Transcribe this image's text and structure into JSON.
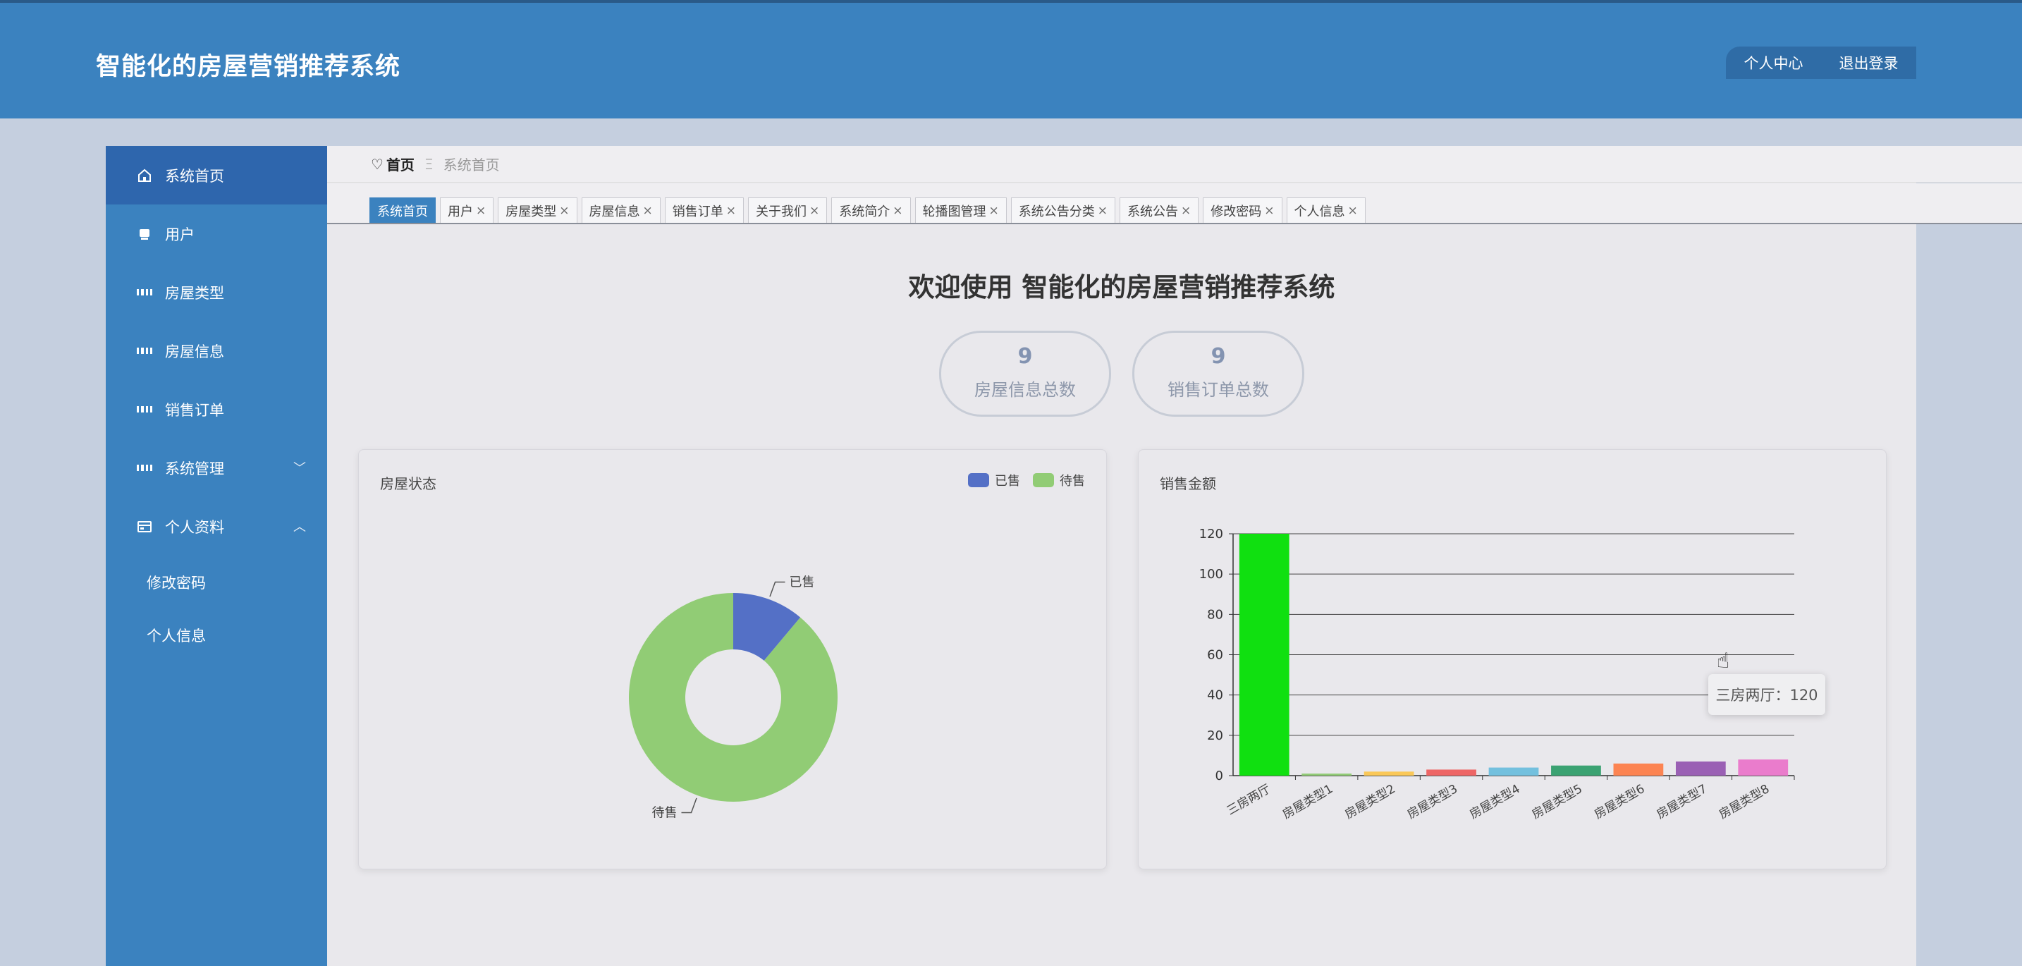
{
  "header": {
    "title": "智能化的房屋营销推荐系统",
    "personal_center": "个人中心",
    "logout": "退出登录"
  },
  "sidebar": {
    "items": [
      {
        "label": "系统首页",
        "icon": "home-icon"
      },
      {
        "label": "用户",
        "icon": "user-icon"
      },
      {
        "label": "房屋类型",
        "icon": "grid-icon"
      },
      {
        "label": "房屋信息",
        "icon": "grid-icon"
      },
      {
        "label": "销售订单",
        "icon": "grid-icon"
      },
      {
        "label": "系统管理",
        "icon": "grid-icon",
        "arrow": "chevron-down-icon"
      },
      {
        "label": "个人资料",
        "icon": "profile-card-icon",
        "arrow": "chevron-up-icon"
      }
    ],
    "subitems": [
      {
        "label": "修改密码"
      },
      {
        "label": "个人信息"
      }
    ]
  },
  "breadcrumb": {
    "home": "首页",
    "separator": "Ξ",
    "current": "系统首页"
  },
  "tabs": [
    {
      "label": "系统首页",
      "closable": false
    },
    {
      "label": "用户"
    },
    {
      "label": "房屋类型"
    },
    {
      "label": "房屋信息"
    },
    {
      "label": "销售订单"
    },
    {
      "label": "关于我们"
    },
    {
      "label": "系统简介"
    },
    {
      "label": "轮播图管理"
    },
    {
      "label": "系统公告分类"
    },
    {
      "label": "系统公告"
    },
    {
      "label": "修改密码"
    },
    {
      "label": "个人信息"
    }
  ],
  "close_glyph": "×",
  "welcome": "欢迎使用 智能化的房屋营销推荐系统",
  "stats": [
    {
      "value": "9",
      "label": "房屋信息总数"
    },
    {
      "value": "9",
      "label": "销售订单总数"
    }
  ],
  "colors": {
    "header_bg": "#3b82bf",
    "sidebar_active": "#2e66ad",
    "pie_sold": "#5470c6",
    "pie_for_sale": "#91cc75"
  },
  "chart_data": [
    {
      "type": "pie",
      "title": "房屋状态",
      "legend_position": "top-right",
      "donut": true,
      "slices": [
        {
          "name": "已售",
          "value": 1,
          "color": "#5470c6"
        },
        {
          "name": "待售",
          "value": 8,
          "color": "#91cc75"
        }
      ]
    },
    {
      "type": "bar",
      "title": "销售金额",
      "categories": [
        "三房两厅",
        "房屋类型1",
        "房屋类型2",
        "房屋类型3",
        "房屋类型4",
        "房屋类型5",
        "房屋类型6",
        "房屋类型7",
        "房屋类型8"
      ],
      "values": [
        120,
        1,
        2,
        3,
        4,
        5,
        6,
        7,
        8
      ],
      "colors": [
        "#10e010",
        "#91cc75",
        "#fac858",
        "#ee6666",
        "#73c0de",
        "#3ba272",
        "#fc8452",
        "#9a60b4",
        "#ea7ccc"
      ],
      "ylim": [
        0,
        120
      ],
      "yticks": [
        0,
        20,
        40,
        60,
        80,
        100,
        120
      ],
      "grid": true,
      "tooltip": "三房两厅：120"
    }
  ]
}
